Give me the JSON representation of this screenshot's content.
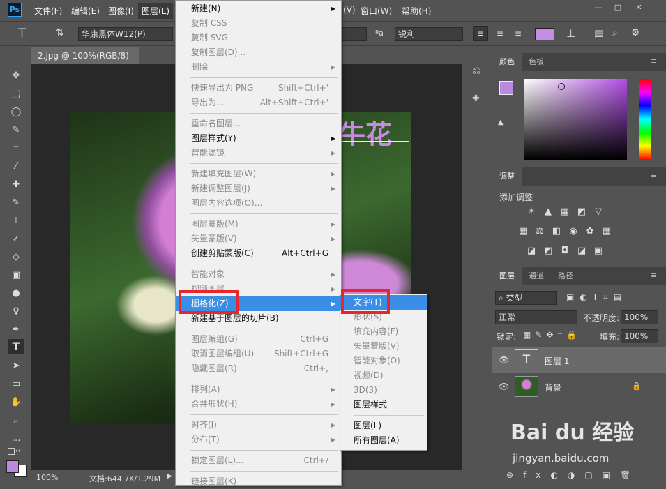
{
  "app": {
    "logo": "Ps",
    "menus": [
      "文件(F)",
      "编辑(E)",
      "图像(I)",
      "图层(L)",
      "(V)",
      "窗口(W)",
      "帮助(H)"
    ],
    "window_controls": [
      "—",
      "□",
      "✕"
    ]
  },
  "options": {
    "font_name": "华康黑体W12(P)",
    "aa_label": "ªa",
    "aa_value": "锐利",
    "color": "#c38ee3"
  },
  "document": {
    "tab_title": "2.jpg @ 100%(RGB/8)",
    "close": "×",
    "canvas_text": "牛花",
    "zoom": "100%",
    "doc_info": "文档:644.7K/1.29M",
    "arrow": "▶"
  },
  "colors": {
    "fg": "#b98ae0",
    "bg": "#ffffff",
    "warn": "▲",
    "picker_hue": "#b14ee4"
  },
  "panels": {
    "color_tabs": [
      "颜色",
      "色板"
    ],
    "adjust": {
      "tab": "调整",
      "add": "添加调整",
      "icons": [
        "☀",
        "▲",
        "▦",
        "◩",
        "▽",
        "▦",
        "⚖",
        "◧",
        "◉",
        "✿",
        "▦",
        "◪",
        "◩",
        "◘",
        "◪",
        "▣"
      ]
    },
    "layers": {
      "tabs": [
        "图层",
        "通道",
        "路径"
      ],
      "filter": "类型",
      "blend": "正常",
      "opacity_label": "不透明度:",
      "opacity": "100%",
      "lock_label": "锁定:",
      "fill_label": "填充:",
      "fill": "100%",
      "rows": [
        {
          "name": "图层 1",
          "thumb": "T"
        },
        {
          "name": "背景"
        }
      ],
      "footer": [
        "⊖",
        "fx",
        "◐",
        "◑",
        "▢",
        "▣",
        "🗑"
      ]
    }
  },
  "menu": {
    "items": [
      {
        "label": "新建(N)",
        "sub": true
      },
      {
        "label": "复制 CSS",
        "dis": true
      },
      {
        "label": "复制 SVG",
        "dis": true
      },
      {
        "label": "复制图层(D)...",
        "dis": true
      },
      {
        "label": "删除",
        "dis": true,
        "sub": true
      },
      {
        "sep": true
      },
      {
        "label": "快速导出为 PNG",
        "sc": "Shift+Ctrl+'",
        "dis": true
      },
      {
        "label": "导出为...",
        "sc": "Alt+Shift+Ctrl+'",
        "dis": true
      },
      {
        "sep": true
      },
      {
        "label": "重命名图层...",
        "dis": true
      },
      {
        "label": "图层样式(Y)",
        "sub": true
      },
      {
        "label": "智能滤镜",
        "dis": true,
        "sub": true
      },
      {
        "sep": true
      },
      {
        "label": "新建填充图层(W)",
        "dis": true,
        "sub": true
      },
      {
        "label": "新建调整图层(J)",
        "dis": true,
        "sub": true
      },
      {
        "label": "图层内容选项(O)...",
        "dis": true
      },
      {
        "sep": true
      },
      {
        "label": "图层蒙版(M)",
        "dis": true,
        "sub": true
      },
      {
        "label": "矢量蒙版(V)",
        "dis": true,
        "sub": true
      },
      {
        "label": "创建剪贴蒙版(C)",
        "sc": "Alt+Ctrl+G"
      },
      {
        "sep": true
      },
      {
        "label": "智能对象",
        "dis": true,
        "sub": true
      },
      {
        "label": "视频图层",
        "dis": true,
        "sub": true
      },
      {
        "label": "栅格化(Z)",
        "sub": true,
        "hl": true
      },
      {
        "label": "新建基于图层的切片(B)"
      },
      {
        "sep": true
      },
      {
        "label": "图层编组(G)",
        "sc": "Ctrl+G",
        "dis": true
      },
      {
        "label": "取消图层编组(U)",
        "sc": "Shift+Ctrl+G",
        "dis": true
      },
      {
        "label": "隐藏图层(R)",
        "sc": "Ctrl+,",
        "dis": true
      },
      {
        "sep": true
      },
      {
        "label": "排列(A)",
        "dis": true,
        "sub": true
      },
      {
        "label": "合并形状(H)",
        "dis": true,
        "sub": true
      },
      {
        "sep": true
      },
      {
        "label": "对齐(I)",
        "dis": true,
        "sub": true
      },
      {
        "label": "分布(T)",
        "dis": true,
        "sub": true
      },
      {
        "sep": true
      },
      {
        "label": "锁定图层(L)...",
        "sc": "Ctrl+/",
        "dis": true
      },
      {
        "sep": true
      },
      {
        "label": "链接图层(K)",
        "dis": true
      }
    ],
    "submenu": [
      {
        "label": "文字(T)",
        "hl": true
      },
      {
        "label": "形状(S)",
        "dis": true
      },
      {
        "label": "填充内容(F)",
        "dis": true
      },
      {
        "label": "矢量蒙版(V)",
        "dis": true
      },
      {
        "label": "智能对象(O)",
        "dis": true
      },
      {
        "label": "视频(D)",
        "dis": true
      },
      {
        "label": "3D(3)",
        "dis": true
      },
      {
        "label": "图层样式"
      },
      {
        "sep": true
      },
      {
        "label": "图层(L)"
      },
      {
        "label": "所有图层(A)"
      }
    ]
  },
  "watermark": {
    "brand": "Bai du 经验",
    "url": "jingyan.baidu.com"
  }
}
